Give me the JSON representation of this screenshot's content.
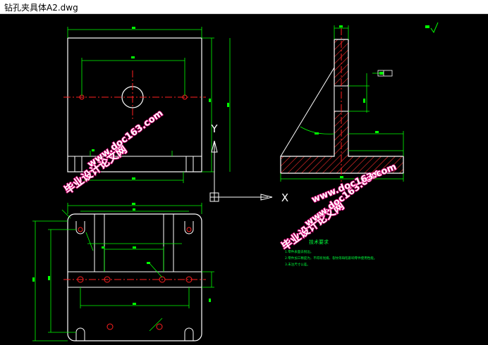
{
  "window": {
    "title": "钻孔夹具体A2.dwg"
  },
  "ucs": {
    "y_label": "Y",
    "x_label": "X"
  },
  "watermarks": [
    {
      "cn": "毕业设计论文网",
      "url": "www.doc163.com"
    },
    {
      "cn": "毕业设计论文网",
      "url": "www.doc163.com"
    },
    {
      "cn": "毕业设计论文网",
      "url": "www.doc163.com"
    }
  ],
  "notes": {
    "heading": "技术要求",
    "lines": [
      "1.零件表面去锐边。",
      "2.零件加工精度为，不得有划痕、裂纹等缺陷影响零件使用性能。",
      "3.未注尺寸公差。"
    ]
  },
  "colors": {
    "background": "#000000",
    "outline": "#ffffff",
    "dimension": "#00ff00",
    "centerline": "#ff2020",
    "hatch": "#ff3030",
    "watermark_fill": "#ffffff",
    "watermark_stroke": "#e0007a"
  }
}
